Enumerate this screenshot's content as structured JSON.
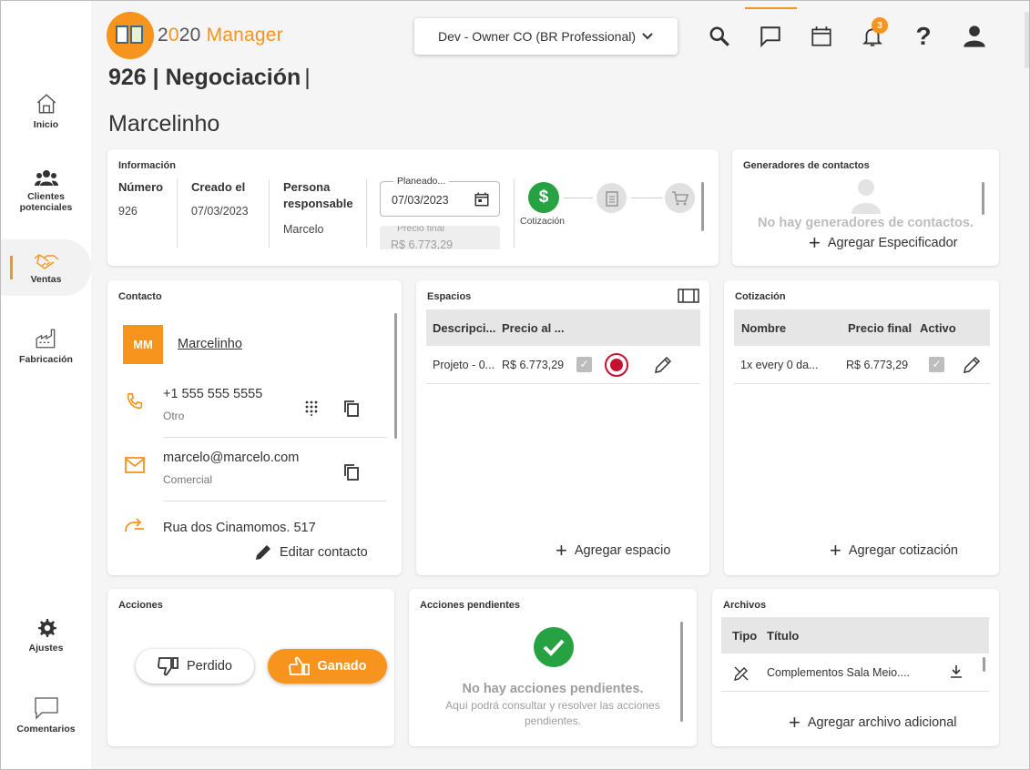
{
  "app": {
    "logo_text_a": "2",
    "logo_text_b": "0",
    "logo_text_c": "20",
    "logo_text_d": " Manager",
    "company_selector": "Dev - Owner CO (BR Professional)",
    "notification_count": "3",
    "accent_color": "#f7941d"
  },
  "sidebar": {
    "items": [
      {
        "label": "Inicio"
      },
      {
        "label": "Clientes potenciales"
      },
      {
        "label": "Ventas"
      },
      {
        "label": "Fabricación"
      },
      {
        "label": "Ajustes"
      },
      {
        "label": "Comentarios"
      }
    ]
  },
  "page": {
    "title": "926 | Negociación",
    "title_pipe": "|",
    "client": "Marcelinho"
  },
  "info": {
    "title": "Información",
    "numero_label": "Número",
    "numero": "926",
    "creado_label": "Creado el",
    "creado": "07/03/2023",
    "persona_label": "Persona responsable",
    "persona": "Marcelo",
    "planeado_label": "Planeado...",
    "planeado": "07/03/2023",
    "precio_label": "Precio final",
    "precio": "R$ 6.773,29",
    "stage_label": "Cotización"
  },
  "generadores": {
    "title": "Generadores de contactos",
    "empty": "No hay generadores de contactos.",
    "add": "Agregar Especificador"
  },
  "contacto": {
    "title": "Contacto",
    "initials": "MM",
    "name": "Marcelinho",
    "phone": "+1 555 555 5555",
    "phone_type": "Otro",
    "email": "marcelo@marcelo.com",
    "email_type": "Comercial",
    "address": "Rua dos Cinamomos. 517",
    "edit": "Editar contacto"
  },
  "espacios": {
    "title": "Espacios",
    "col_desc": "Descripci...",
    "col_price": "Precio al ...",
    "row_desc": "Projeto - 0...",
    "row_price": "R$ 6.773,29",
    "add": "Agregar espacio"
  },
  "cotizacion": {
    "title": "Cotización",
    "col_name": "Nombre",
    "col_price": "Precio final",
    "col_active": "Activo",
    "row_name": "1x every 0 da...",
    "row_price": "R$ 6.773,29",
    "add": "Agregar cotización"
  },
  "acciones": {
    "title": "Acciones",
    "lost": "Perdido",
    "won": "Ganado"
  },
  "pendientes": {
    "title": "Acciones pendientes",
    "empty": "No hay acciones pendientes.",
    "hint": "Aquí podrá consultar y resolver las acciones pendientes."
  },
  "archivos": {
    "title": "Archivos",
    "col_type": "Tipo",
    "col_title": "Título",
    "row1": "Complementos Sala Meio....",
    "add": "Agregar archivo adicional"
  }
}
